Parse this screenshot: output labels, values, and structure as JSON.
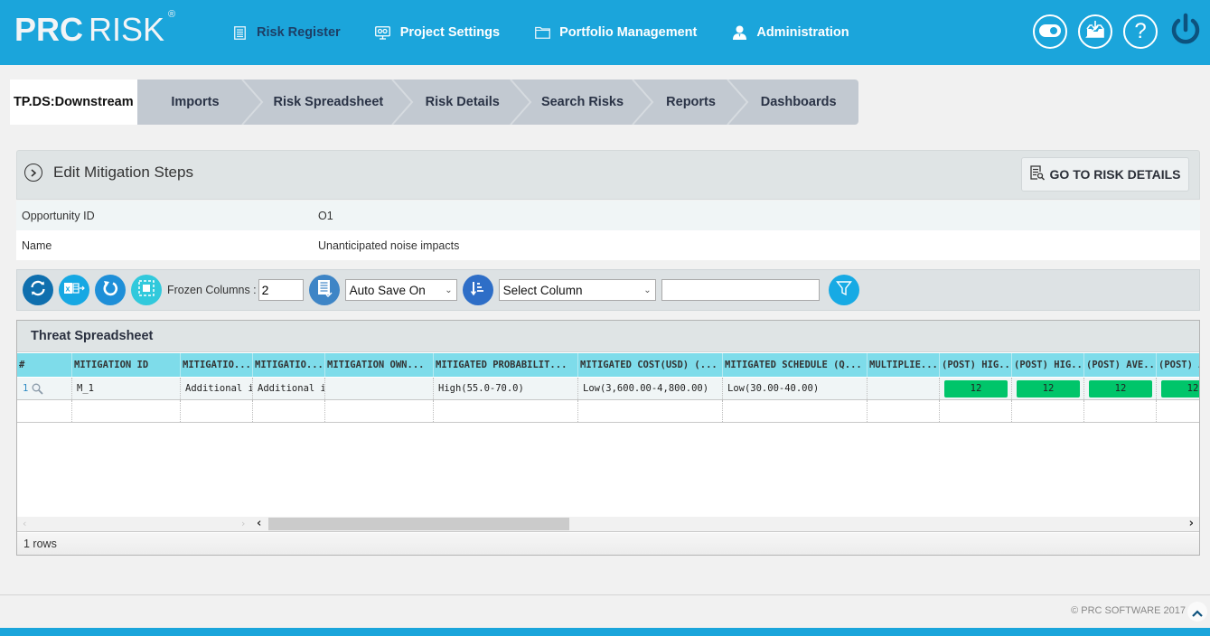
{
  "app": {
    "logo_main": "PRC",
    "logo_sub": "RISK",
    "logo_mark": "®"
  },
  "nav": {
    "items": [
      {
        "label": "Risk Register",
        "icon": "list-document-icon",
        "active": true
      },
      {
        "label": "Project Settings",
        "icon": "monitor-settings-icon",
        "active": false
      },
      {
        "label": "Portfolio Management",
        "icon": "folder-icon",
        "active": false
      },
      {
        "label": "Administration",
        "icon": "user-icon",
        "active": false
      }
    ],
    "right_icons": [
      "toggle-icon",
      "inbox-download-icon",
      "help-icon",
      "power-icon"
    ],
    "help_glyph": "?"
  },
  "breadcrumb": {
    "project": "TP.DS:Downstream",
    "tabs": [
      "Imports",
      "Risk Spreadsheet",
      "Risk Details",
      "Search Risks",
      "Reports",
      "Dashboards"
    ]
  },
  "panel": {
    "title": "Edit Mitigation Steps",
    "go_button": "GO TO RISK DETAILS",
    "fields": [
      {
        "label": "Opportunity ID",
        "value": "O1"
      },
      {
        "label": "Name",
        "value": "Unanticipated noise impacts"
      }
    ]
  },
  "toolbar": {
    "frozen_label": "Frozen Columns :",
    "frozen_value": "2",
    "autosave_value": "Auto Save On",
    "column_select_value": "Select Column",
    "filter_value": ""
  },
  "grid": {
    "title": "Threat Spreadsheet",
    "columns": [
      "#",
      "MITIGATION ID",
      "MITIGATIO...",
      "MITIGATIO...",
      "MITIGATION OWN...",
      "MITIGATED PROBABILIT...",
      "MITIGATED COST(USD) (...",
      "MITIGATED SCHEDULE (Q...",
      "MULTIPLIE...",
      "(POST) HIG...",
      "(POST) HIG...",
      "(POST) AVE...",
      "(POST) A"
    ],
    "rows": [
      {
        "num": "1",
        "cells": [
          "M_1",
          "Additional i...",
          "Additional i...",
          "",
          "High(55.0-70.0)",
          "Low(3,600.00-4,800.00)",
          "Low(30.00-40.00)",
          ""
        ],
        "scores": [
          "12",
          "12",
          "12",
          "12"
        ]
      }
    ],
    "score_color": "#00c56a",
    "row_count": "1 rows"
  },
  "footer": {
    "copyright": "© PRC SOFTWARE 2017"
  },
  "colors": {
    "brand": "#1ba5db",
    "header_cell": "#7edcea",
    "active_nav": "#1d3f66"
  }
}
